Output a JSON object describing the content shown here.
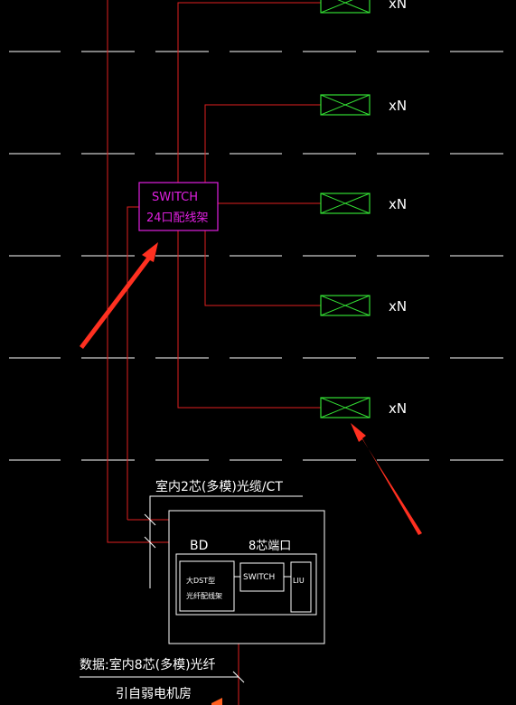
{
  "colors": {
    "background": "#000000",
    "wire": "#e02020",
    "outlet": "#33dd33",
    "switch": "#e020e0",
    "text": "#ffffff",
    "arrow": "#ff3020"
  },
  "outlet_label": "xN",
  "outlets": [
    {
      "label": "xN"
    },
    {
      "label": "xN"
    },
    {
      "label": "xN"
    },
    {
      "label": "xN"
    },
    {
      "label": "xN"
    }
  ],
  "floor_switch": {
    "line1": "SWITCH",
    "line2": "24口配线架"
  },
  "riser_cable_label": "室内2芯(多模)光缆/CT",
  "bd": {
    "label": "BD",
    "port_label": "8芯端口",
    "patch_panel_line1": "大DST型",
    "patch_panel_line2": "光纤配线架",
    "switch_label": "SWITCH",
    "liu_label": "LIU"
  },
  "incoming_cable_label": "数据:室内8芯(多模)光纤",
  "source_label": "引自弱电机房"
}
